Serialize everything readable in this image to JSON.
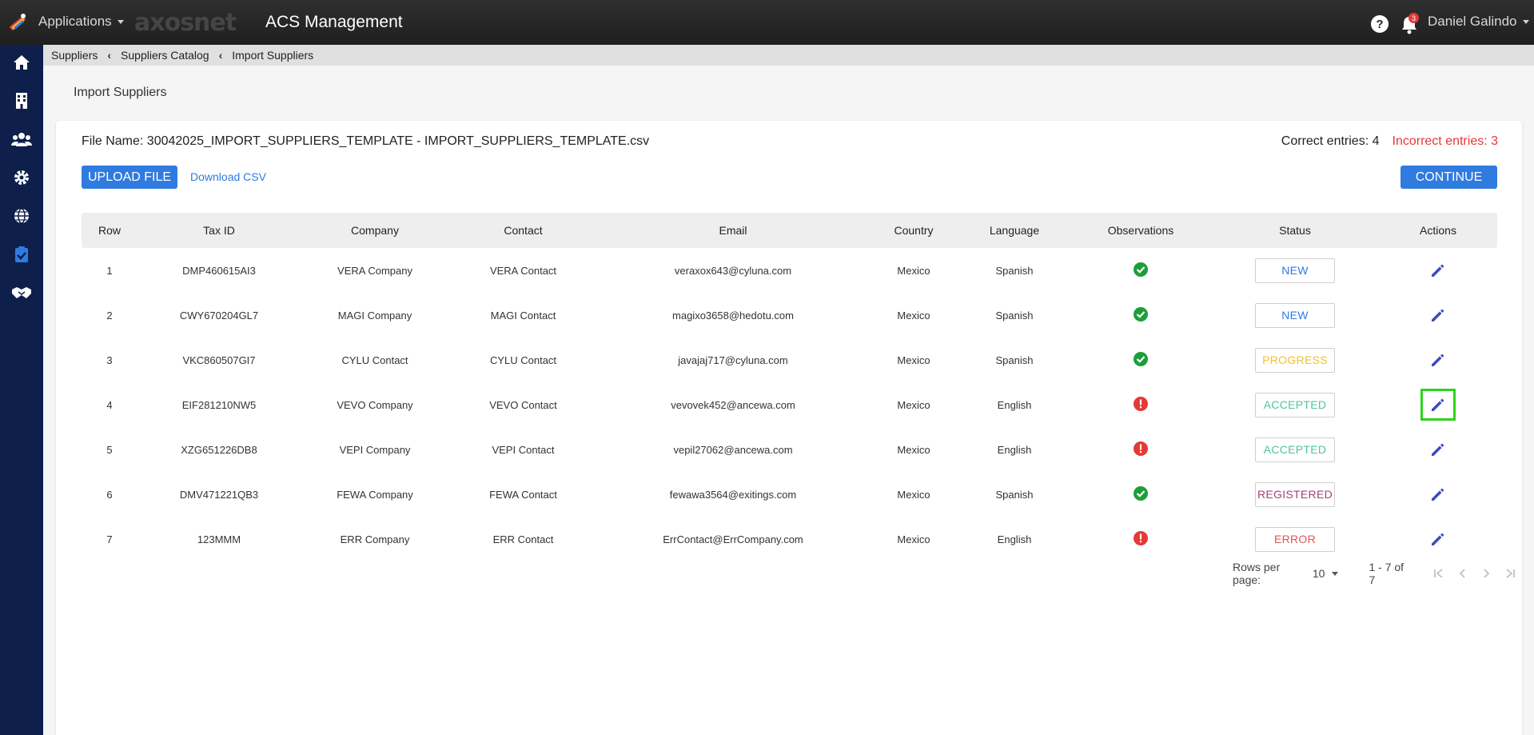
{
  "header": {
    "apps_label": "Applications",
    "logo_text": "axosnet",
    "title": "ACS Management",
    "help_glyph": "?",
    "notifications_count": "3",
    "user_name": "Daniel Galindo"
  },
  "sidebar": {
    "items": [
      {
        "name": "home",
        "icon": "home-icon"
      },
      {
        "name": "buildings",
        "icon": "building-icon"
      },
      {
        "name": "users",
        "icon": "users-icon"
      },
      {
        "name": "settings",
        "icon": "gear-icon"
      },
      {
        "name": "globe",
        "icon": "globe-icon"
      },
      {
        "name": "tasks",
        "icon": "clipboard-check-icon",
        "active": true
      },
      {
        "name": "partners",
        "icon": "handshake-icon"
      }
    ]
  },
  "breadcrumb": [
    "Suppliers",
    "Suppliers Catalog",
    "Import Suppliers"
  ],
  "page_title": "Import Suppliers",
  "file": {
    "label": "File Name: 30042025_IMPORT_SUPPLIERS_TEMPLATE - IMPORT_SUPPLIERS_TEMPLATE.csv",
    "correct": "Correct entries: 4",
    "incorrect": "Incorrect entries: 3"
  },
  "buttons": {
    "upload": "UPLOAD FILE",
    "download": "Download CSV",
    "continue": "CONTINUE"
  },
  "table": {
    "headers": [
      "Row",
      "Tax ID",
      "Company",
      "Contact",
      "Email",
      "Country",
      "Language",
      "Observations",
      "Status",
      "Actions"
    ],
    "rows": [
      {
        "row": "1",
        "tax_id": "DMP460615AI3",
        "company": "VERA Company",
        "contact": "VERA Contact",
        "email": "veraxox643@cyluna.com",
        "country": "Mexico",
        "language": "Spanish",
        "obs": "ok",
        "status": "NEW"
      },
      {
        "row": "2",
        "tax_id": "CWY670204GL7",
        "company": "MAGI Company",
        "contact": "MAGI Contact",
        "email": "magixo3658@hedotu.com",
        "country": "Mexico",
        "language": "Spanish",
        "obs": "ok",
        "status": "NEW"
      },
      {
        "row": "3",
        "tax_id": "VKC860507GI7",
        "company": "CYLU Contact",
        "contact": "CYLU Contact",
        "email": "javajaj717@cyluna.com",
        "country": "Mexico",
        "language": "Spanish",
        "obs": "ok",
        "status": "PROGRESS"
      },
      {
        "row": "4",
        "tax_id": "EIF281210NW5",
        "company": "VEVO Company",
        "contact": "VEVO Contact",
        "email": "vevovek452@ancewa.com",
        "country": "Mexico",
        "language": "English",
        "obs": "error",
        "status": "ACCEPTED"
      },
      {
        "row": "5",
        "tax_id": "XZG651226DB8",
        "company": "VEPI Company",
        "contact": "VEPI Contact",
        "email": "vepil27062@ancewa.com",
        "country": "Mexico",
        "language": "English",
        "obs": "error",
        "status": "ACCEPTED"
      },
      {
        "row": "6",
        "tax_id": "DMV471221QB3",
        "company": "FEWA Company",
        "contact": "FEWA Contact",
        "email": "fewawa3564@exitings.com",
        "country": "Mexico",
        "language": "Spanish",
        "obs": "ok",
        "status": "REGISTERED"
      },
      {
        "row": "7",
        "tax_id": "123MMM",
        "company": "ERR Company",
        "contact": "ERR Contact",
        "email": "ErrContact@ErrCompany.com",
        "country": "Mexico",
        "language": "English",
        "obs": "error",
        "status": "ERROR"
      }
    ],
    "focused_row": 3
  },
  "status_colors": {
    "NEW": "#2f7be0",
    "PROGRESS": "#f2c12e",
    "ACCEPTED": "#4fc3a1",
    "REGISTERED": "#a0457a",
    "ERROR": "#e05555"
  },
  "colors": {
    "ok": "#1e9e3a",
    "error": "#e53935",
    "edit": "#3b4cc0",
    "accent": "#2f7be0"
  },
  "pagination": {
    "rows_per_page_label": "Rows per page:",
    "rows_per_page": "10",
    "range": "1 - 7 of 7"
  }
}
